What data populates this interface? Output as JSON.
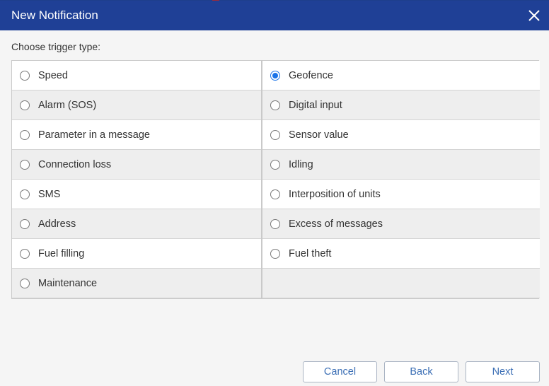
{
  "dialog": {
    "title": "New Notification",
    "prompt": "Choose trigger type:"
  },
  "triggers": {
    "left": [
      "Speed",
      "Alarm (SOS)",
      "Parameter in a message",
      "Connection loss",
      "SMS",
      "Address",
      "Fuel filling",
      "Maintenance"
    ],
    "right": [
      "Geofence",
      "Digital input",
      "Sensor value",
      "Idling",
      "Interposition of units",
      "Excess of messages",
      "Fuel theft"
    ],
    "selected": "Geofence"
  },
  "buttons": {
    "cancel": "Cancel",
    "back": "Back",
    "next": "Next"
  },
  "colors": {
    "header": "#1f4096",
    "radio_checked": "#1a73e8",
    "button_text": "#3c6fb5"
  }
}
